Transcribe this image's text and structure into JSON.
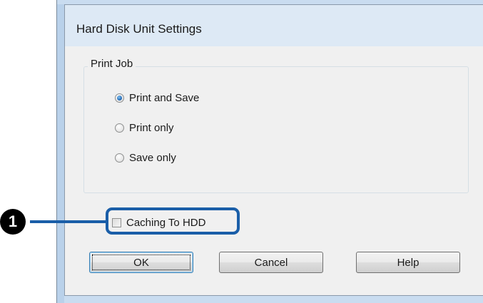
{
  "dialog": {
    "title": "Hard Disk Unit Settings"
  },
  "print_job": {
    "group_label": "Print Job",
    "options": [
      {
        "label": "Print and Save",
        "selected": true
      },
      {
        "label": "Print only",
        "selected": false
      },
      {
        "label": "Save only",
        "selected": false
      }
    ]
  },
  "caching": {
    "label": "Caching To HDD",
    "checked": false
  },
  "callout": {
    "number": "❶"
  },
  "buttons": {
    "ok": "OK",
    "cancel": "Cancel",
    "help": "Help"
  },
  "colors": {
    "highlight": "#1a5ea8",
    "title_bar": "#dde9f5",
    "dialog_bg": "#f0f0f0"
  }
}
